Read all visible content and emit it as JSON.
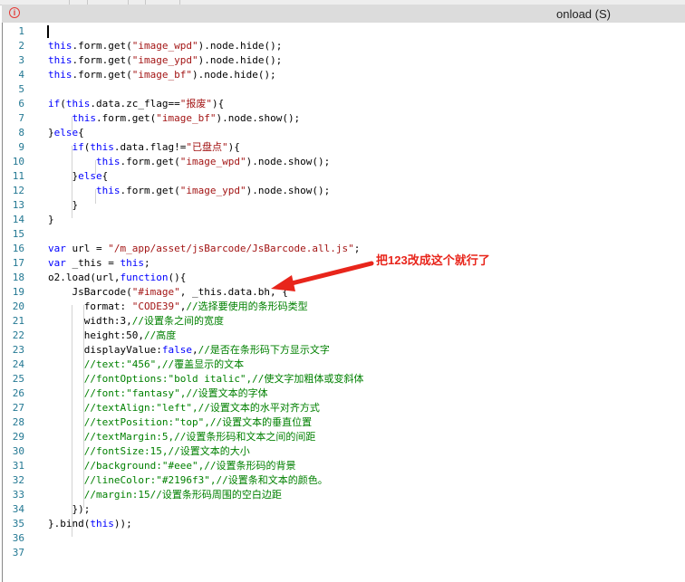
{
  "header": {
    "title": "onload (S)",
    "icon": "error-info-icon"
  },
  "annotation": {
    "text": "把123改成这个就行了",
    "color": "#e8251b"
  },
  "lines": [
    [],
    [
      [
        "this",
        "k"
      ],
      [
        ".form.",
        "p"
      ],
      [
        "get",
        "p"
      ],
      [
        "(",
        "p"
      ],
      [
        "\"image_wpd\"",
        "s"
      ],
      [
        ").node.hide();",
        "p"
      ]
    ],
    [
      [
        "this",
        "k"
      ],
      [
        ".form.get(",
        "p"
      ],
      [
        "\"image_ypd\"",
        "s"
      ],
      [
        ").node.hide();",
        "p"
      ]
    ],
    [
      [
        "this",
        "k"
      ],
      [
        ".form.get(",
        "p"
      ],
      [
        "\"image_bf\"",
        "s"
      ],
      [
        ").node.hide();",
        "p"
      ]
    ],
    [],
    [
      [
        "if",
        "k"
      ],
      [
        "(",
        "p"
      ],
      [
        "this",
        "k"
      ],
      [
        ".data.zc_flag==",
        "p"
      ],
      [
        "\"报废\"",
        "s"
      ],
      [
        "){",
        "p"
      ]
    ],
    [
      [
        "    ",
        "p"
      ],
      [
        "this",
        "k"
      ],
      [
        ".form.get(",
        "p"
      ],
      [
        "\"image_bf\"",
        "s"
      ],
      [
        ").node.show();",
        "p"
      ]
    ],
    [
      [
        "}",
        "p"
      ],
      [
        "else",
        "k"
      ],
      [
        "{",
        "p"
      ]
    ],
    [
      [
        "    ",
        "p"
      ],
      [
        "if",
        "k"
      ],
      [
        "(",
        "p"
      ],
      [
        "this",
        "k"
      ],
      [
        ".data.flag!=",
        "p"
      ],
      [
        "\"已盘点\"",
        "s"
      ],
      [
        "){",
        "p"
      ]
    ],
    [
      [
        "        ",
        "p"
      ],
      [
        "this",
        "k"
      ],
      [
        ".form.get(",
        "p"
      ],
      [
        "\"image_wpd\"",
        "s"
      ],
      [
        ").node.show();",
        "p"
      ]
    ],
    [
      [
        "    }",
        "p"
      ],
      [
        "else",
        "k"
      ],
      [
        "{",
        "p"
      ]
    ],
    [
      [
        "        ",
        "p"
      ],
      [
        "this",
        "k"
      ],
      [
        ".form.get(",
        "p"
      ],
      [
        "\"image_ypd\"",
        "s"
      ],
      [
        ").node.show();",
        "p"
      ]
    ],
    [
      [
        "    }",
        "p"
      ]
    ],
    [
      [
        "}",
        "p"
      ]
    ],
    [],
    [
      [
        "var",
        "k"
      ],
      [
        " url = ",
        "p"
      ],
      [
        "\"/m_app/asset/jsBarcode/JsBarcode.all.js\"",
        "s"
      ],
      [
        ";",
        "p"
      ]
    ],
    [
      [
        "var",
        "k"
      ],
      [
        " _this = ",
        "p"
      ],
      [
        "this",
        "k"
      ],
      [
        ";",
        "p"
      ]
    ],
    [
      [
        "o2.load(url,",
        "p"
      ],
      [
        "function",
        "k"
      ],
      [
        "(){",
        "p"
      ]
    ],
    [
      [
        "    JsBarcode(",
        "p"
      ],
      [
        "\"#image\"",
        "s"
      ],
      [
        ", _this.data.bh, {",
        "p"
      ]
    ],
    [
      [
        "      format: ",
        "p"
      ],
      [
        "\"CODE39\"",
        "s"
      ],
      [
        ",",
        "p"
      ],
      [
        "//选择要使用的条形码类型",
        "c"
      ]
    ],
    [
      [
        "      width:3,",
        "p"
      ],
      [
        "//设置条之间的宽度",
        "c"
      ]
    ],
    [
      [
        "      height:50,",
        "p"
      ],
      [
        "//高度",
        "c"
      ]
    ],
    [
      [
        "      displayValue:",
        "p"
      ],
      [
        "false",
        "k"
      ],
      [
        ",",
        "p"
      ],
      [
        "//是否在条形码下方显示文字",
        "c"
      ]
    ],
    [
      [
        "      ",
        "p"
      ],
      [
        "//text:\"456\",//覆盖显示的文本",
        "c"
      ]
    ],
    [
      [
        "      ",
        "p"
      ],
      [
        "//fontOptions:\"bold italic\",//使文字加粗体或变斜体",
        "c"
      ]
    ],
    [
      [
        "      ",
        "p"
      ],
      [
        "//font:\"fantasy\",//设置文本的字体",
        "c"
      ]
    ],
    [
      [
        "      ",
        "p"
      ],
      [
        "//textAlign:\"left\",//设置文本的水平对齐方式",
        "c"
      ]
    ],
    [
      [
        "      ",
        "p"
      ],
      [
        "//textPosition:\"top\",//设置文本的垂直位置",
        "c"
      ]
    ],
    [
      [
        "      ",
        "p"
      ],
      [
        "//textMargin:5,//设置条形码和文本之间的间距",
        "c"
      ]
    ],
    [
      [
        "      ",
        "p"
      ],
      [
        "//fontSize:15,//设置文本的大小",
        "c"
      ]
    ],
    [
      [
        "      ",
        "p"
      ],
      [
        "//background:\"#eee\",//设置条形码的背景",
        "c"
      ]
    ],
    [
      [
        "      ",
        "p"
      ],
      [
        "//lineColor:\"#2196f3\",//设置条和文本的颜色。",
        "c"
      ]
    ],
    [
      [
        "      ",
        "p"
      ],
      [
        "//margin:15//设置条形码周围的空白边距",
        "c"
      ]
    ],
    [
      [
        "    });",
        "p"
      ]
    ],
    [
      [
        "}.bind(",
        "p"
      ],
      [
        "this",
        "k"
      ],
      [
        "));",
        "p"
      ]
    ],
    [],
    []
  ]
}
